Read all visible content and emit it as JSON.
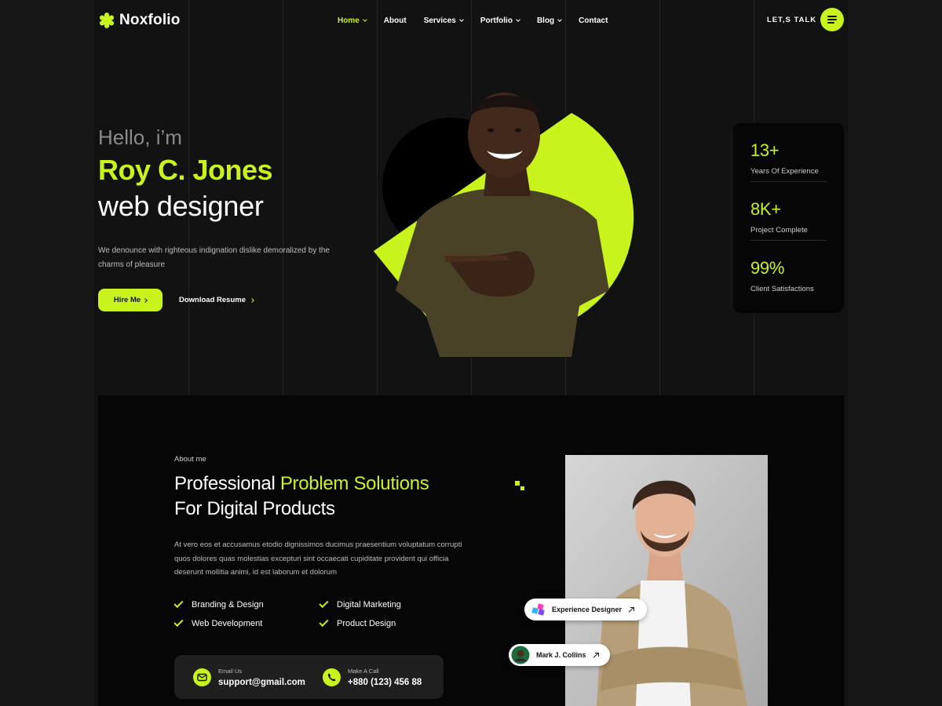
{
  "colors": {
    "accent": "#c8f31d",
    "background": "#121212",
    "panel": "#060606"
  },
  "brand": {
    "name": "Noxfolio",
    "icon": "asterisk-logo-icon"
  },
  "nav": {
    "items": [
      {
        "label": "Home",
        "active": true,
        "dropdown": true
      },
      {
        "label": "About",
        "active": false,
        "dropdown": false
      },
      {
        "label": "Services",
        "active": false,
        "dropdown": true
      },
      {
        "label": "Portfolio",
        "active": false,
        "dropdown": true
      },
      {
        "label": "Blog",
        "active": false,
        "dropdown": true
      },
      {
        "label": "Contact",
        "active": false,
        "dropdown": false
      }
    ],
    "cta_label": "LET,S TALK",
    "menu_icon": "hamburger-menu-icon"
  },
  "hero": {
    "greeting": "Hello, i’m",
    "name": "Roy C. Jones",
    "role": "web designer",
    "description": "We denounce with righteous indignation dislike demoralized by the charms of pleasure",
    "hire_label": "Hire Me",
    "download_label": "Download Resume",
    "photo": "smiling-man-pointing-photo"
  },
  "stats": [
    {
      "value": "13+",
      "label": "Years Of Experience"
    },
    {
      "value": "8K+",
      "label": "Project Complete"
    },
    {
      "value": "99%",
      "label": "Client Satisfactions"
    }
  ],
  "about": {
    "eyebrow": "About me",
    "title_part1": "Professional ",
    "title_highlight": "Problem Solutions",
    "title_line2": "For Digital Products",
    "text": "At vero eos et accusamus etodio dignissimos ducimus praesentium voluptatum corrupti quos dolores quas molestias excepturi sint occaecati cupiditate provident qui officia deserunt mollitia animi, id est laborum et dolorum",
    "skills": [
      "Branding & Design",
      "Digital Marketing",
      "Web Development",
      "Product Design"
    ],
    "contact": {
      "email_label": "Email Us",
      "email": "support@gmail.com",
      "phone_label": "Make A Call",
      "phone": "+880 (123) 456 88"
    },
    "photo": "smiling-man-arms-crossed-photo",
    "badges": [
      {
        "label": "Experience Designer",
        "icon": "cubes-logo-icon"
      },
      {
        "label": "Mark J. Collins",
        "icon": "avatar"
      }
    ]
  }
}
